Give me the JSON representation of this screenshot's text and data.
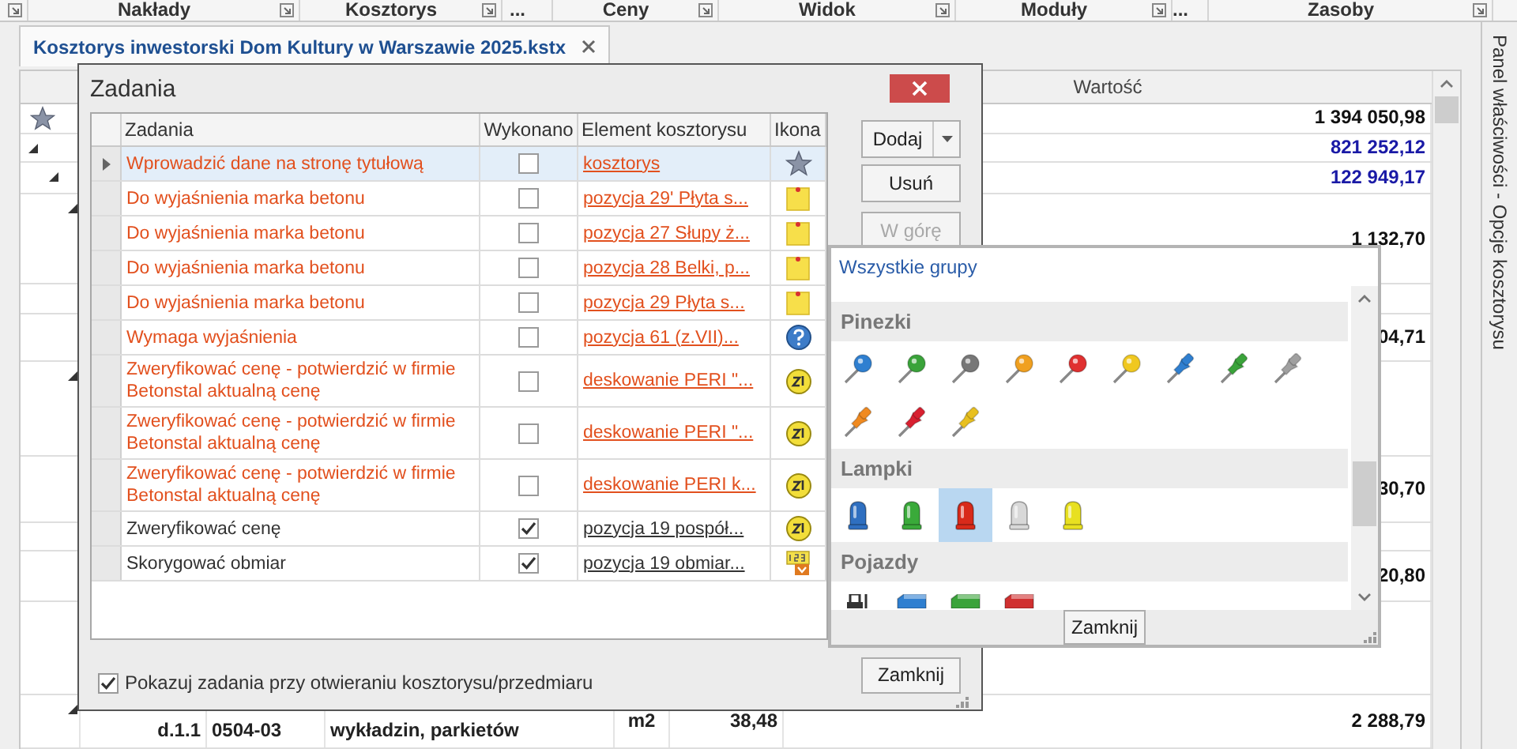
{
  "ribbon_groups": [
    {
      "label": "Nakłady",
      "launcher": true
    },
    {
      "label": "Kosztorys",
      "launcher": true
    },
    {
      "label": "...",
      "launcher": false
    },
    {
      "label": "Ceny",
      "launcher": true
    },
    {
      "label": "Widok",
      "launcher": true
    },
    {
      "label": "Moduły",
      "launcher": true
    },
    {
      "label": "...",
      "launcher": false
    },
    {
      "label": "Zasoby",
      "launcher": true
    }
  ],
  "document_tab": {
    "title": "Kosztorys inwestorski Dom Kultury w Warszawie 2025.kstx"
  },
  "side_panel": {
    "title": "Panel właściwości - Opcje kosztorysu"
  },
  "estimate_grid": {
    "header": "Wartość",
    "rows": [
      {
        "kind": "star",
        "value": "1 394 050,98",
        "color": "#111111"
      },
      {
        "kind": "expander",
        "value": "821 252,12",
        "color": "#1a1aa6"
      },
      {
        "kind": "expander",
        "value": "122 949,17",
        "color": "#1a1aa6"
      },
      {
        "kind": "expander",
        "value": "1 132,70",
        "color": "#111111"
      },
      {
        "kind": "plain"
      },
      {
        "kind": "plain",
        "value": "04,71",
        "color": "#111111"
      },
      {
        "kind": "expander"
      },
      {
        "kind": "plain",
        "value": "30,70",
        "color": "#111111"
      },
      {
        "kind": "plain"
      },
      {
        "kind": "plain",
        "value": "20,80",
        "color": "#111111"
      },
      {
        "kind": "plain"
      },
      {
        "kind": "expander",
        "number": "d.1.1",
        "code": "0504-03",
        "description": "wykładzin, parkietów",
        "unit": "m2",
        "quantity": "38,48",
        "value": "2 288,79",
        "color": "#111111"
      }
    ]
  },
  "dialog": {
    "title": "Zadania",
    "columns": [
      "Zadania",
      "Wykonano",
      "Element kosztorysu",
      "Ikona"
    ],
    "tasks": [
      {
        "text": "Wprowadzić dane na stronę tytułową",
        "done": false,
        "link": "kosztorys",
        "kind": "star",
        "selected": true
      },
      {
        "text": "Do wyjaśnienia marka betonu",
        "done": false,
        "link": "pozycja 29' Płyta s...",
        "kind": "note",
        "selected": false
      },
      {
        "text": "Do wyjaśnienia marka betonu",
        "done": false,
        "link": "pozycja 27 Słupy ż...",
        "kind": "note",
        "selected": false
      },
      {
        "text": "Do wyjaśnienia marka betonu",
        "done": false,
        "link": "pozycja 28 Belki, p...",
        "kind": "note",
        "selected": false
      },
      {
        "text": "Do wyjaśnienia marka betonu",
        "done": false,
        "link": "pozycja 29 Płyta s...",
        "kind": "note",
        "selected": false
      },
      {
        "text": "Wymaga wyjaśnienia",
        "done": false,
        "link": "pozycja 61 (z.VII)...",
        "kind": "question",
        "selected": false
      },
      {
        "text": "Zweryfikować cenę - potwierdzić w firmie Betonstal aktualną cenę",
        "done": false,
        "link": "deskowanie PERI \"...",
        "kind": "coin",
        "selected": false
      },
      {
        "text": "Zweryfikować cenę - potwierdzić w firmie Betonstal aktualną cenę",
        "done": false,
        "link": "deskowanie PERI \"...",
        "kind": "coin",
        "selected": false
      },
      {
        "text": "Zweryfikować cenę - potwierdzić w firmie Betonstal aktualną cenę",
        "done": false,
        "link": "deskowanie PERI k...",
        "kind": "coin",
        "selected": false
      },
      {
        "text": "Zweryfikować cenę",
        "done": true,
        "link": "pozycja 19 pospół...",
        "kind": "coin",
        "selected": false
      },
      {
        "text": "Skorygować obmiar",
        "done": true,
        "link": "pozycja 19 obmiar...",
        "kind": "calc",
        "selected": false
      }
    ],
    "buttons": [
      {
        "label": "Dodaj",
        "kind": "split",
        "disabled": false
      },
      {
        "label": "Usuń",
        "kind": "plain",
        "disabled": false
      },
      {
        "label": "W górę",
        "kind": "plain",
        "disabled": true
      }
    ],
    "show_on_open": {
      "label": "Pokazuj zadania przy otwieraniu kosztorysu/przedmiaru",
      "checked": true
    },
    "close_button": "Zamknij"
  },
  "icon_picker": {
    "title": "Wszystkie grupy",
    "groups": [
      {
        "name": "Pinezki",
        "icons": [
          {
            "kind": "round-pin",
            "color": "#2f7fd0",
            "selected": false
          },
          {
            "kind": "round-pin",
            "color": "#3aa33a",
            "selected": false
          },
          {
            "kind": "round-pin",
            "color": "#777777",
            "selected": false
          },
          {
            "kind": "round-pin",
            "color": "#f0a020",
            "selected": false
          },
          {
            "kind": "round-pin",
            "color": "#e03030",
            "selected": false
          },
          {
            "kind": "round-pin",
            "color": "#f0c820",
            "selected": false
          },
          {
            "kind": "push-pin",
            "color": "#2f7fd0",
            "selected": false
          },
          {
            "kind": "push-pin",
            "color": "#3aa33a",
            "selected": false
          },
          {
            "kind": "push-pin",
            "color": "#a0a0a0",
            "selected": false
          },
          {
            "kind": "push-pin",
            "color": "#f08a20",
            "selected": false
          },
          {
            "kind": "push-pin",
            "color": "#d82030",
            "selected": false
          },
          {
            "kind": "push-pin",
            "color": "#e8c020",
            "selected": false
          }
        ]
      },
      {
        "name": "Lampki",
        "icons": [
          {
            "kind": "lamp",
            "color": "#2f6fc0",
            "selected": false
          },
          {
            "kind": "lamp",
            "color": "#3aaa3a",
            "selected": false
          },
          {
            "kind": "lamp",
            "color": "#d82a1a",
            "selected": true
          },
          {
            "kind": "lamp",
            "color": "#d8d8d8",
            "selected": false
          },
          {
            "kind": "lamp",
            "color": "#e8e020",
            "selected": false
          }
        ]
      },
      {
        "name": "Pojazdy",
        "icons": [
          {
            "kind": "forklift",
            "color": "#333333",
            "selected": false
          },
          {
            "kind": "truck",
            "color": "#2f7fd0",
            "selected": false
          },
          {
            "kind": "truck",
            "color": "#3aa33a",
            "selected": false
          },
          {
            "kind": "truck",
            "color": "#d03030",
            "selected": false
          }
        ]
      }
    ],
    "close_button": "Zamknij"
  }
}
